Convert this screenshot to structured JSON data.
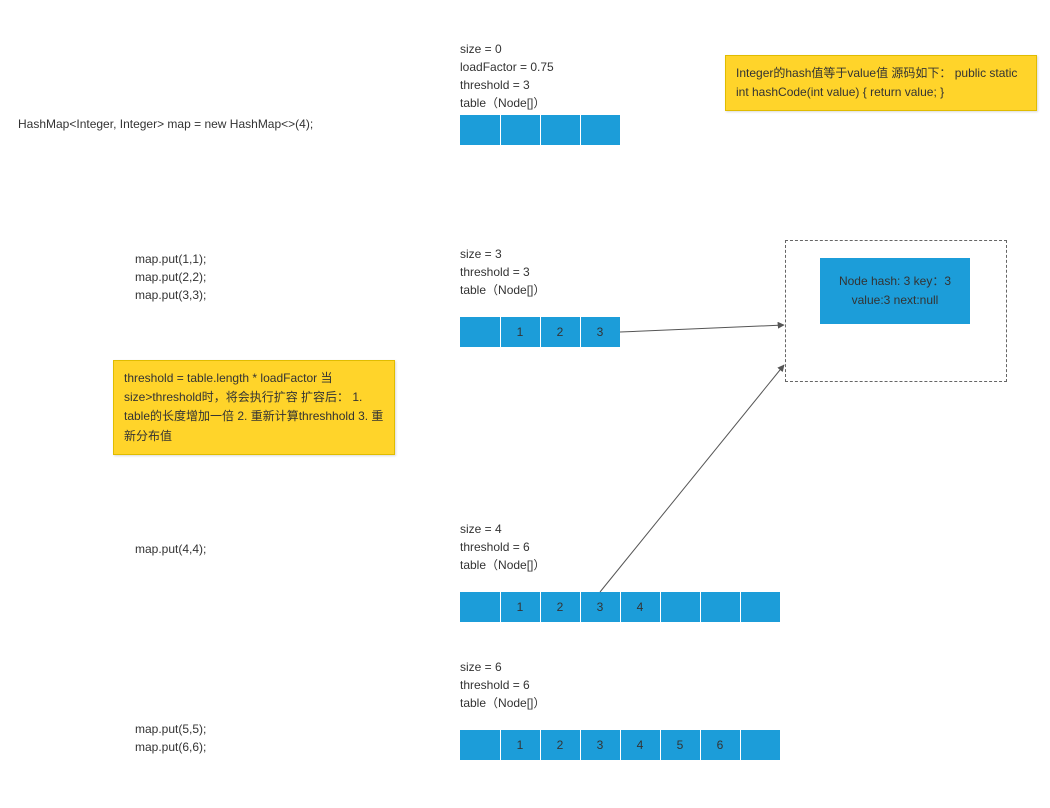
{
  "declLine": "HashMap<Integer, Integer> map = new HashMap<>(4);",
  "block1": {
    "code": "map.put(1,1);\nmap.put(2,2);\nmap.put(3,3);"
  },
  "block2": {
    "code": "map.put(4,4);"
  },
  "block3": {
    "code": "map.put(5,5);\nmap.put(6,6);"
  },
  "state0": {
    "text": "size = 0\nloadFactor = 0.75\nthreshold = 3\ntable（Node[]）"
  },
  "state1": {
    "text": "size = 3\nthreshold = 3\ntable（Node[]）",
    "cells": [
      "",
      "1",
      "2",
      "3"
    ]
  },
  "state2": {
    "text": "size = 4\nthreshold = 6\ntable（Node[]）",
    "cells": [
      "",
      "1",
      "2",
      "3",
      "4",
      "",
      "",
      ""
    ]
  },
  "state3": {
    "text": "size = 6\nthreshold = 6\ntable（Node[]）",
    "cells": [
      "",
      "1",
      "2",
      "3",
      "4",
      "5",
      "6",
      ""
    ]
  },
  "noteHash": "Integer的hash值等于value值\n源码如下：\n    public static int hashCode(int value) {\n        return value;\n    }",
  "noteResize": "threshold = table.length * loadFactor\n当size>threshold时，将会执行扩容\n扩容后：\n1. table的长度增加一倍\n2. 重新计算threshhold\n3. 重新分布值",
  "nodeDetail": "Node\nhash: 3\nkey：3\nvalue:3\nnext:null"
}
